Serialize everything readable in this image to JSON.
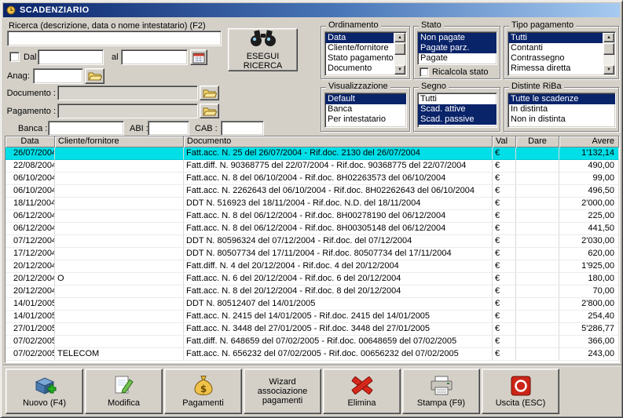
{
  "window": {
    "title": "SCADENZIARIO"
  },
  "search": {
    "ricerca_label": "Ricerca (descrizione, data o nome intestatario) (F2)",
    "dal_label": "Dal",
    "al_label": "al",
    "anag_label": "Anag:",
    "documento_label": "Documento :",
    "pagamento_label": "Pagamento :",
    "banca_label": "Banca :",
    "abi_label": "ABI :",
    "cab_label": "CAB :",
    "esegui_label": "ESEGUI RICERCA"
  },
  "fields": {
    "ricerca": "",
    "dal": "",
    "al": "",
    "anag": "",
    "documento": "",
    "pagamento": "",
    "banca": "",
    "abi": "",
    "cab": ""
  },
  "groups": {
    "ordinamento": {
      "title": "Ordinamento",
      "items": [
        "Data",
        "Cliente/fornitore",
        "Stato pagamento",
        "Documento"
      ]
    },
    "stato": {
      "title": "Stato",
      "items": [
        "Non pagate",
        "Pagate parz.",
        "Pagate"
      ],
      "checkbox_label": "Ricalcola stato"
    },
    "tipo_pagamento": {
      "title": "Tipo pagamento",
      "items": [
        "Tutti",
        "Contanti",
        "Contrassegno",
        "Rimessa diretta"
      ]
    },
    "visualizzazione": {
      "title": "Visualizzazione",
      "items": [
        "Default",
        "Banca",
        "Per intestatario"
      ]
    },
    "segno": {
      "title": "Segno",
      "items": [
        "Tutti",
        "Scad. attive",
        "Scad. passive"
      ]
    },
    "distinte_riba": {
      "title": "Distinte RiBa",
      "items": [
        "Tutte le scadenze",
        "In distinta",
        "Non in distinta"
      ]
    }
  },
  "table": {
    "columns": [
      "Data",
      "Cliente/fornitore",
      "Documento",
      "Val",
      "Dare",
      "Avere"
    ],
    "rows": [
      {
        "data": "26/07/2004",
        "cliente": "",
        "documento": "Fatt.acc. N. 25 del 26/07/2004 - Rif.doc. 2130 del 26/07/2004",
        "val": "€",
        "dare": "",
        "avere": "1'132,14",
        "selected": true
      },
      {
        "data": "22/08/2004",
        "cliente": "",
        "documento": "Fatt.diff. N. 90368775 del 22/07/2004 - Rif.doc. 90368775 del 22/07/2004",
        "val": "€",
        "dare": "",
        "avere": "490,00",
        "selected": false
      },
      {
        "data": "06/10/2004",
        "cliente": "",
        "documento": "Fatt.acc. N. 8 del 06/10/2004 - Rif.doc. 8H02263573 del 06/10/2004",
        "val": "€",
        "dare": "",
        "avere": "99,00",
        "selected": false
      },
      {
        "data": "06/10/2004",
        "cliente": "",
        "documento": "Fatt.acc. N. 2262643 del 06/10/2004 - Rif.doc. 8H02262643 del 06/10/2004",
        "val": "€",
        "dare": "",
        "avere": "496,50",
        "selected": false
      },
      {
        "data": "18/11/2004",
        "cliente": "",
        "documento": "DDT N. 516923 del 18/11/2004 - Rif.doc. N.D. del 18/11/2004",
        "val": "€",
        "dare": "",
        "avere": "2'000,00",
        "selected": false
      },
      {
        "data": "06/12/2004",
        "cliente": "",
        "documento": "Fatt.acc. N. 8 del 06/12/2004 - Rif.doc. 8H00278190 del 06/12/2004",
        "val": "€",
        "dare": "",
        "avere": "225,00",
        "selected": false
      },
      {
        "data": "06/12/2004",
        "cliente": "",
        "documento": "Fatt.acc. N. 8 del 06/12/2004 - Rif.doc. 8H00305148 del 06/12/2004",
        "val": "€",
        "dare": "",
        "avere": "441,50",
        "selected": false
      },
      {
        "data": "07/12/2004",
        "cliente": "",
        "documento": "DDT N. 80596324 del 07/12/2004 - Rif.doc. del 07/12/2004",
        "val": "€",
        "dare": "",
        "avere": "2'030,00",
        "selected": false
      },
      {
        "data": "17/12/2004",
        "cliente": "",
        "documento": "DDT N. 80507734 del 17/11/2004 - Rif.doc. 80507734 del 17/11/2004",
        "val": "€",
        "dare": "",
        "avere": "620,00",
        "selected": false
      },
      {
        "data": "20/12/2004",
        "cliente": "",
        "documento": "Fatt.diff. N. 4 del 20/12/2004 - Rif.doc. 4 del 20/12/2004",
        "val": "€",
        "dare": "",
        "avere": "1'925,00",
        "selected": false
      },
      {
        "data": "20/12/2004",
        "cliente": "O",
        "documento": "Fatt.acc. N. 6 del 20/12/2004 - Rif.doc. 6 del 20/12/2004",
        "val": "€",
        "dare": "",
        "avere": "180,00",
        "selected": false
      },
      {
        "data": "20/12/2004",
        "cliente": "",
        "documento": "Fatt.acc. N. 8 del 20/12/2004 - Rif.doc. 8 del 20/12/2004",
        "val": "€",
        "dare": "",
        "avere": "70,00",
        "selected": false
      },
      {
        "data": "14/01/2005",
        "cliente": "",
        "documento": "DDT N. 80512407 del 14/01/2005",
        "val": "€",
        "dare": "",
        "avere": "2'800,00",
        "selected": false
      },
      {
        "data": "14/01/2005",
        "cliente": "",
        "documento": "Fatt.acc. N. 2415 del 14/01/2005 - Rif.doc. 2415 del 14/01/2005",
        "val": "€",
        "dare": "",
        "avere": "254,40",
        "selected": false
      },
      {
        "data": "27/01/2005",
        "cliente": "",
        "documento": "Fatt.acc. N. 3448 del 27/01/2005 - Rif.doc. 3448 del 27/01/2005",
        "val": "€",
        "dare": "",
        "avere": "5'286,77",
        "selected": false
      },
      {
        "data": "07/02/2005",
        "cliente": "",
        "documento": "Fatt.diff. N. 648659 del 07/02/2005 - Rif.doc. 00648659 del 07/02/2005",
        "val": "€",
        "dare": "",
        "avere": "366,00",
        "selected": false
      },
      {
        "data": "07/02/2005",
        "cliente": "TELECOM",
        "documento": "Fatt.acc. N. 656232 del 07/02/2005 - Rif.doc. 00656232 del 07/02/2005",
        "val": "€",
        "dare": "",
        "avere": "243,00",
        "selected": false
      }
    ]
  },
  "toolbar": {
    "buttons": [
      {
        "label": "Nuovo (F4)",
        "icon": "new-record-icon"
      },
      {
        "label": "Modifica",
        "icon": "edit-icon"
      },
      {
        "label": "Pagamenti",
        "icon": "money-bag-icon"
      },
      {
        "label": "Wizard associazione pagamenti",
        "icon": ""
      },
      {
        "label": "Elimina",
        "icon": "delete-x-icon"
      },
      {
        "label": "Stampa (F9)",
        "icon": "printer-icon"
      },
      {
        "label": "Uscita (ESC)",
        "icon": "exit-power-icon"
      }
    ]
  },
  "colors": {
    "face": "#d4d0c8",
    "titlebar_gradient_start": "#0a246a",
    "titlebar_gradient_end": "#a6caf0",
    "list_selection": "#0a246a",
    "selected_row_highlight": "#00dfe7"
  }
}
